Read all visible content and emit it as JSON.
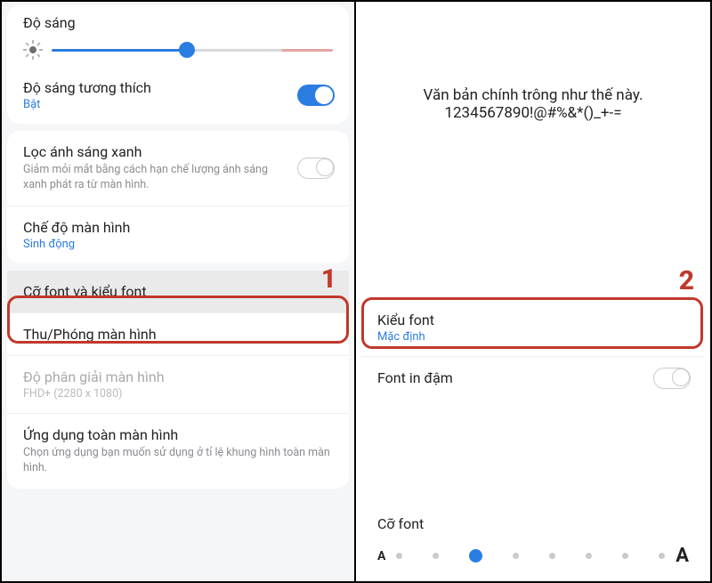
{
  "left": {
    "brightness_label": "Độ sáng",
    "adaptive": {
      "title": "Độ sáng tương thích",
      "status": "Bật",
      "on": true
    },
    "bluelight": {
      "title": "Lọc ánh sáng xanh",
      "desc": "Giảm mỏi mắt bằng cách hạn chế lượng ánh sáng xanh phát ra từ màn hình.",
      "on": false
    },
    "screen_mode": {
      "title": "Chế độ màn hình",
      "value": "Sinh động"
    },
    "font_item": {
      "title": "Cỡ font và kiểu font"
    },
    "zoom_item": {
      "title": "Thu/Phóng màn hình"
    },
    "resolution": {
      "title": "Độ phân giải màn hình",
      "value": "FHD+ (2280 x 1080)"
    },
    "fullscreen": {
      "title": "Ứng dụng toàn màn hình",
      "desc": "Chọn ứng dụng bạn muốn sử dụng ở tỉ lệ khung hình toàn màn hình."
    },
    "step": "1"
  },
  "right": {
    "preview_line1": "Văn bản chính trông như thế này.",
    "preview_line2": "1234567890!@#%&*()_+-=",
    "font_style": {
      "title": "Kiểu font",
      "value": "Mặc định"
    },
    "bold": {
      "title": "Font in đậm",
      "on": false
    },
    "font_size_label": "Cỡ font",
    "step": "2"
  }
}
